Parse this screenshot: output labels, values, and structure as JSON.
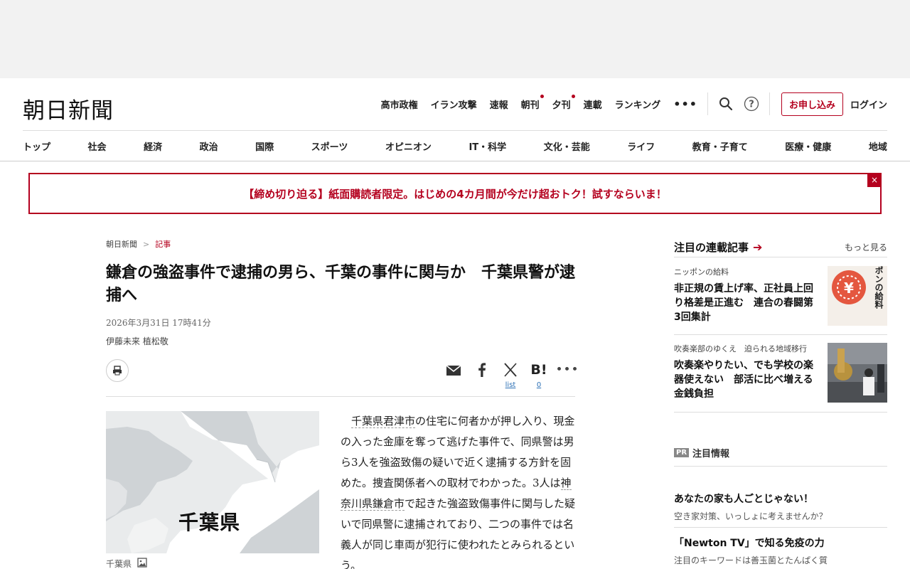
{
  "header": {
    "logo": "朝日新聞",
    "top_links": [
      {
        "label": "高市政権",
        "dot": false
      },
      {
        "label": "イラン攻撃",
        "dot": false
      },
      {
        "label": "速報",
        "dot": false
      },
      {
        "label": "朝刊",
        "dot": true
      },
      {
        "label": "夕刊",
        "dot": true
      },
      {
        "label": "連載",
        "dot": false
      },
      {
        "label": "ランキング",
        "dot": false
      }
    ],
    "more": "•••",
    "subscribe_label": "お申し込み",
    "login_label": "ログイン",
    "sections": [
      "トップ",
      "社会",
      "経済",
      "政治",
      "国際",
      "スポーツ",
      "オピニオン",
      "IT・科学",
      "文化・芸能",
      "ライフ",
      "教育・子育て",
      "医療・健康",
      "地域"
    ]
  },
  "banner": {
    "text": "【締め切り迫る】紙面購読者限定。はじめの4カ月間が今だけ超おトク！試すならいま！",
    "close": "×"
  },
  "article": {
    "breadcrumb": [
      "朝日新聞",
      "記事"
    ],
    "breadcrumb_sep": ">",
    "headline": "鎌倉の強盗事件で逮捕の男ら、千葉の事件に関与か　千葉県警が逮捕へ",
    "date": "2026年3月31日 17時41分",
    "byline": "伊藤未来 植松敬",
    "share": {
      "x_count": "list",
      "hatena_label": "B!",
      "hatena_count": "0",
      "more": "•••"
    },
    "map_label": "千葉県",
    "caption": "千葉県",
    "body": {
      "kw1": "千葉県君津市",
      "p1a": "の住宅に何者かが押し入り、現金の入った金庫を奪って逃げた事件で、同県警は男ら3人を強盗致傷の疑いで近く逮捕する方針を固めた。捜査関係者への取材でわかった。3人は",
      "kw2": "神奈川県鎌倉市",
      "p1b": "で起きた強盗致傷事件に関与した疑いで同県警に逮捕されており、二つの事件では名義人が同じ車両が犯行に使われたとみられるという。"
    }
  },
  "sidebar": {
    "title": "注目の連載記事",
    "more": "もっと見る",
    "cards": [
      {
        "category": "ニッポンの給料",
        "title": "非正規の賃上げ率、正社員上回り格差是正進む　連合の春闘第3回集計",
        "thumb_text": "ニッポンの給料"
      },
      {
        "category": "吹奏楽部のゆくえ　迫られる地域移行",
        "title": "吹奏楽やりたい、でも学校の楽器使えない　部活に比べ増える金銭負担"
      }
    ],
    "pr_badge": "PR",
    "pr_label": "注目情報",
    "pr_items": [
      {
        "title": "あなたの家も人ごとじゃない！",
        "sub": "空き家対策、いっしょに考えませんか？"
      },
      {
        "title": "「Newton TV」で知る免疫の力",
        "sub": "注目のキーワードは善玉菌とたんぱく質"
      }
    ]
  },
  "colors": {
    "accent": "#b4001e",
    "link_blue": "#2a6fb5",
    "map_land": "#ffffff",
    "map_sea": "#cfd3d6"
  }
}
